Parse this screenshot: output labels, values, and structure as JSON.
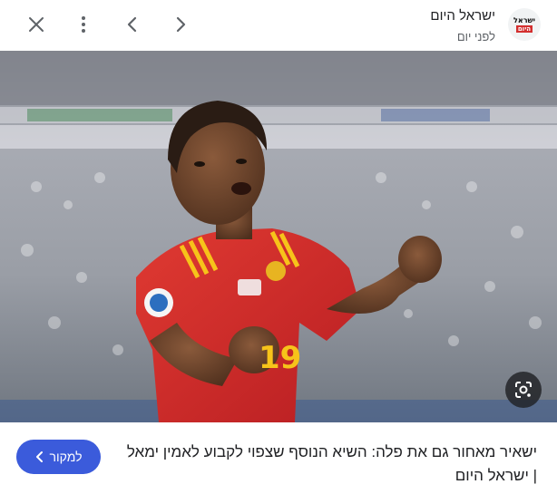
{
  "source": {
    "name": "ישראל היום",
    "time": "לפני יום",
    "logo_text_top": "ישראל",
    "logo_text_bottom": "היום"
  },
  "toolbar": {
    "icons": [
      "close-icon",
      "more-vert-icon",
      "chevron-left-icon",
      "chevron-right-icon"
    ]
  },
  "image": {
    "jersey_number": "19",
    "lens_icon": "google-lens-icon"
  },
  "caption": {
    "title": "ישאיר מאחור גם את פלה: השיא הנוסף שצפוי לקבוע לאמין ימאל | ישראל היום"
  },
  "visit_button": {
    "label": "למקור",
    "icon": "chevron-left-icon"
  },
  "colors": {
    "accent": "#3b5bdb",
    "jersey_red": "#d22a2a",
    "jersey_yellow": "#f7c31a"
  }
}
